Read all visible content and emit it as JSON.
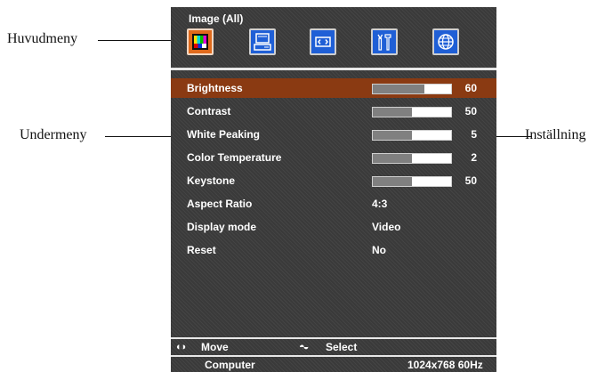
{
  "callouts": {
    "main_menu": "Huvudmeny",
    "submenu": "Undermeny",
    "setting": "Inställning"
  },
  "osd": {
    "title": "Image (All)",
    "tabs": [
      {
        "icon": "color-bars-icon",
        "active": true
      },
      {
        "icon": "computer-icon",
        "active": false
      },
      {
        "icon": "screen-resize-icon",
        "active": false
      },
      {
        "icon": "tools-icon",
        "active": false
      },
      {
        "icon": "globe-icon",
        "active": false
      }
    ],
    "rows": [
      {
        "label": "Brightness",
        "type": "slider",
        "level_percent": 66,
        "value": "60",
        "selected": true
      },
      {
        "label": "Contrast",
        "type": "slider",
        "level_percent": 50,
        "value": "50",
        "selected": false
      },
      {
        "label": "White Peaking",
        "type": "slider",
        "level_percent": 50,
        "value": "5",
        "selected": false
      },
      {
        "label": "Color Temperature",
        "type": "slider",
        "level_percent": 50,
        "value": "2",
        "selected": false
      },
      {
        "label": "Keystone",
        "type": "slider",
        "level_percent": 50,
        "value": "50",
        "selected": false
      },
      {
        "label": "Aspect Ratio",
        "type": "text",
        "value": "4:3",
        "selected": false
      },
      {
        "label": "Display mode",
        "type": "text",
        "value": "Video",
        "selected": false
      },
      {
        "label": "Reset",
        "type": "text",
        "value": "No",
        "selected": false
      }
    ],
    "footer": {
      "move_label": "Move",
      "select_label": "Select",
      "source": "Computer",
      "resolution": "1024x768 60Hz"
    },
    "colors": {
      "selected_row": "#8a3a12",
      "active_tab": "#e06a1c",
      "tab": "#1f5fd6",
      "background": "#3a3a3a"
    }
  }
}
